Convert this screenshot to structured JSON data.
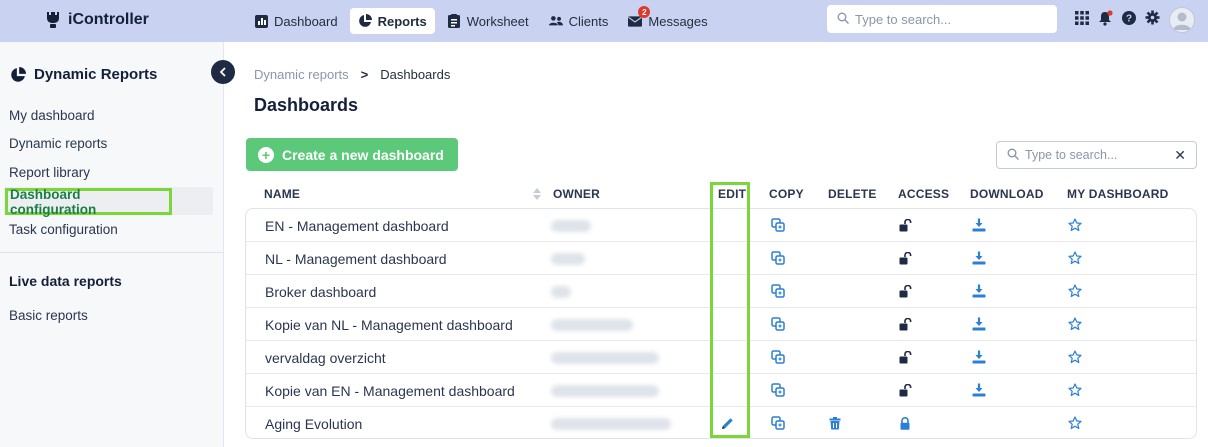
{
  "brand": {
    "name": "iController"
  },
  "nav": {
    "items": [
      {
        "label": "Dashboard",
        "icon": "chart-icon",
        "active": false
      },
      {
        "label": "Reports",
        "icon": "pie-chart-icon",
        "active": true
      },
      {
        "label": "Worksheet",
        "icon": "clipboard-icon",
        "active": false
      },
      {
        "label": "Clients",
        "icon": "users-icon",
        "active": false
      },
      {
        "label": "Messages",
        "icon": "envelope-icon",
        "active": false,
        "badge": "2"
      }
    ]
  },
  "search": {
    "placeholder": "Type to search..."
  },
  "sidebar": {
    "title": "Dynamic Reports",
    "items": [
      "My dashboard",
      "Dynamic reports",
      "Report library",
      "Dashboard configuration",
      "Task configuration"
    ],
    "active_item": "Dashboard configuration",
    "section_title": "Live data reports",
    "section_items": [
      "Basic reports"
    ]
  },
  "breadcrumb": {
    "parent": "Dynamic reports",
    "separator": ">",
    "current": "Dashboards"
  },
  "page": {
    "title": "Dashboards",
    "create_button": "Create a new dashboard"
  },
  "table": {
    "search_placeholder": "Type to search...",
    "columns": [
      "NAME",
      "OWNER",
      "EDIT",
      "COPY",
      "DELETE",
      "ACCESS",
      "DOWNLOAD",
      "MY DASHBOARD"
    ],
    "rows": [
      {
        "name": "EN - Management dashboard",
        "editable": false,
        "deletable": false,
        "access": "unlocked",
        "downloadable": true
      },
      {
        "name": "NL - Management dashboard",
        "editable": false,
        "deletable": false,
        "access": "unlocked",
        "downloadable": true
      },
      {
        "name": "Broker dashboard",
        "editable": false,
        "deletable": false,
        "access": "unlocked",
        "downloadable": true
      },
      {
        "name": "Kopie van NL - Management dashboard",
        "editable": false,
        "deletable": false,
        "access": "unlocked",
        "downloadable": true
      },
      {
        "name": "vervaldag overzicht",
        "editable": false,
        "deletable": false,
        "access": "unlocked",
        "downloadable": true
      },
      {
        "name": "Kopie van EN - Management dashboard",
        "editable": false,
        "deletable": false,
        "access": "unlocked",
        "downloadable": true
      },
      {
        "name": "Aging Evolution",
        "editable": true,
        "deletable": true,
        "access": "locked",
        "downloadable": false
      }
    ]
  },
  "colors": {
    "topbar": "#c9d2f0",
    "accent_green": "#5cc87a",
    "highlight": "#7bd63a",
    "icon_blue": "#2b7fd4",
    "text_dark": "#14203a"
  }
}
